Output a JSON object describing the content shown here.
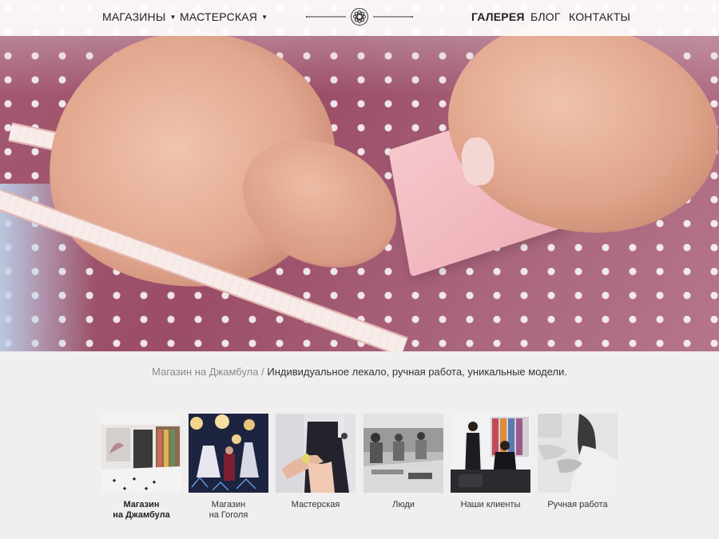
{
  "nav": {
    "left": [
      {
        "label": "МАГАЗИНЫ",
        "has_dropdown": true
      },
      {
        "label": "МАСТЕРСКАЯ",
        "has_dropdown": true
      }
    ],
    "right": [
      {
        "label": "ГАЛЕРЕЯ",
        "active": true
      },
      {
        "label": "БЛОГ",
        "active": false
      },
      {
        "label": "КОНТАКТЫ",
        "active": false
      }
    ],
    "logo_icon": "ornament-flower-logo"
  },
  "hero": {
    "image_icon": "hero-sewing-photo"
  },
  "caption": {
    "location": "Магазин на Джамбула",
    "separator": " / ",
    "text": "Индивидуальное лекало, ручная работа, уникальные модели."
  },
  "gallery": [
    {
      "line1": "Магазин",
      "line2": "на Джамбула",
      "active": true
    },
    {
      "line1": "Магазин",
      "line2": "на Гоголя",
      "active": false
    },
    {
      "line1": "Мастерская",
      "line2": "",
      "active": false
    },
    {
      "line1": "Люди",
      "line2": "",
      "active": false
    },
    {
      "line1": "Наши клиенты",
      "line2": "",
      "active": false
    },
    {
      "line1": "Ручная работа",
      "line2": "",
      "active": false
    }
  ],
  "colors": {
    "accent_fabric": "#9b4d67",
    "page_bg": "#f1eeef",
    "text": "#333333",
    "muted": "#8b8b8b"
  }
}
